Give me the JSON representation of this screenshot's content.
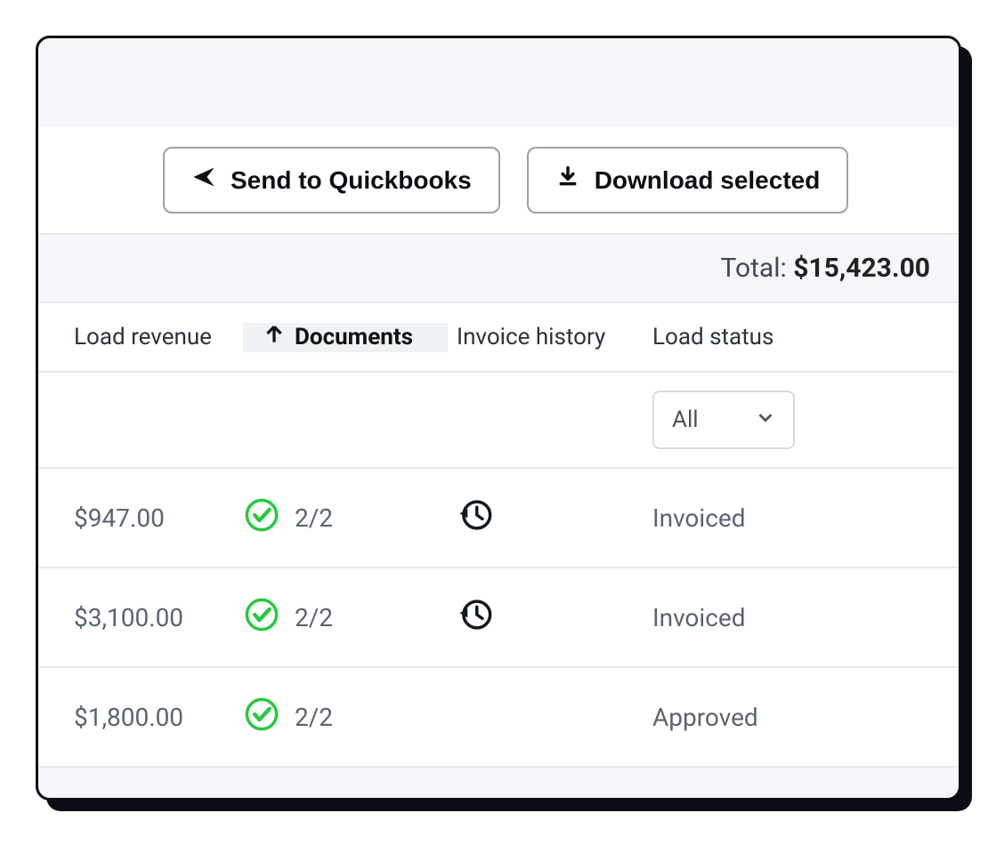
{
  "toolbar": {
    "send_label": "Send to Quickbooks",
    "download_label": "Download selected"
  },
  "total": {
    "label": "Total: ",
    "amount": "$15,423.00"
  },
  "columns": {
    "revenue": "Load revenue",
    "documents": "Documents",
    "history": "Invoice history",
    "status": "Load status"
  },
  "filters": {
    "status_value": "All"
  },
  "rows": [
    {
      "revenue": "$947.00",
      "documents": "2/2",
      "has_history": true,
      "status": "Invoiced"
    },
    {
      "revenue": "$3,100.00",
      "documents": "2/2",
      "has_history": true,
      "status": "Invoiced"
    },
    {
      "revenue": "$1,800.00",
      "documents": "2/2",
      "has_history": false,
      "status": "Approved"
    }
  ]
}
